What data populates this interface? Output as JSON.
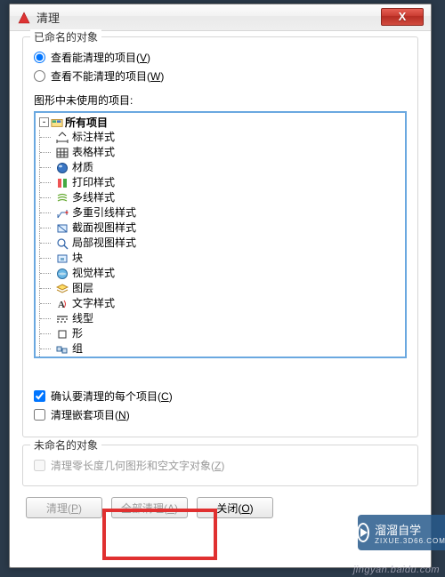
{
  "window": {
    "title": "清理",
    "close": "X"
  },
  "named_objects": {
    "legend": "已命名的对象",
    "radio_viewable": "查看能清理的项目",
    "radio_viewable_key": "V",
    "radio_not_viewable": "查看不能清理的项目",
    "radio_not_viewable_key": "W",
    "tree_label": "图形中未使用的项目:",
    "root": "所有项目",
    "items": [
      "标注样式",
      "表格样式",
      "材质",
      "打印样式",
      "多线样式",
      "多重引线样式",
      "截面视图样式",
      "局部视图样式",
      "块",
      "视觉样式",
      "图层",
      "文字样式",
      "线型",
      "形",
      "组"
    ],
    "confirm_each": "确认要清理的每个项目",
    "confirm_each_key": "C",
    "purge_nested": "清理嵌套项目",
    "purge_nested_key": "N"
  },
  "unnamed_objects": {
    "legend": "未命名的对象",
    "zero_length": "清理零长度几何图形和空文字对象",
    "zero_length_key": "Z"
  },
  "buttons": {
    "purge": "清理",
    "purge_key": "P",
    "purge_all": "全部清理",
    "purge_all_key": "A",
    "close": "关闭",
    "close_key": "O"
  },
  "branding": {
    "site": "溜溜自学",
    "site_sub": "ZIXUE.3D66.COM",
    "watermark": "jingyan.baidu.com"
  }
}
